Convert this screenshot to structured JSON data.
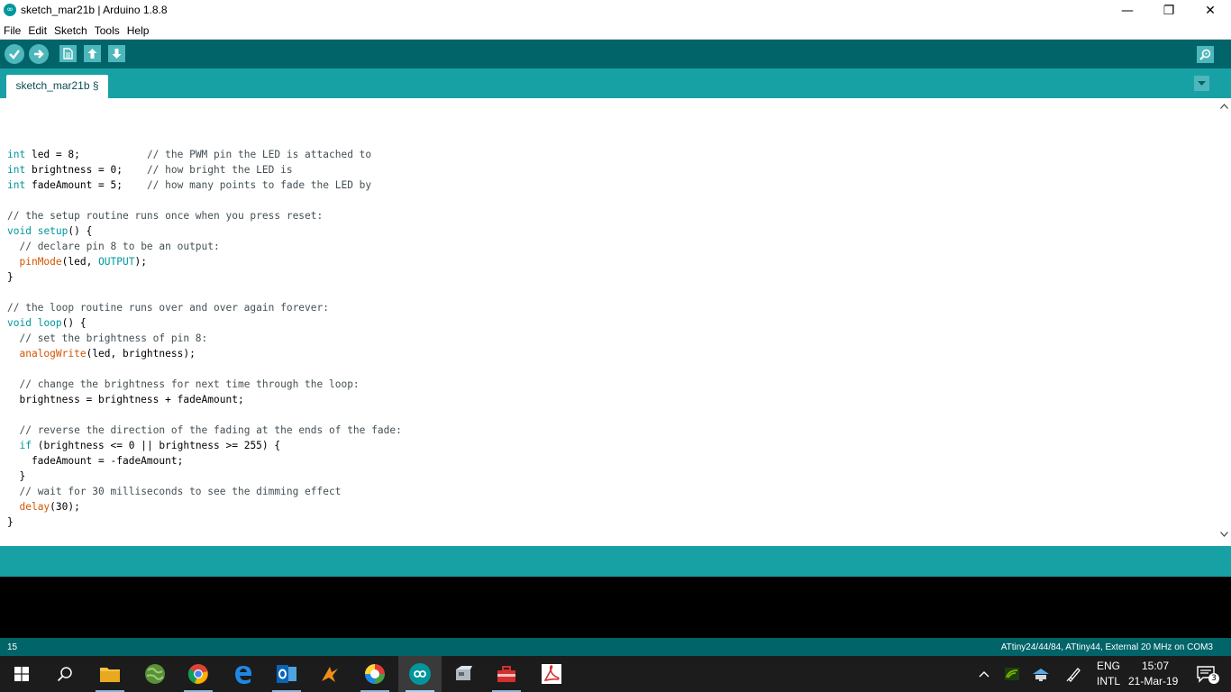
{
  "window": {
    "title": "sketch_mar21b | Arduino 1.8.8",
    "app_icon": "∞",
    "minimize": "—",
    "maximize": "❐",
    "close": "✕"
  },
  "menu": [
    "File",
    "Edit",
    "Sketch",
    "Tools",
    "Help"
  ],
  "tab": {
    "label": "sketch_mar21b §"
  },
  "code_lines": [
    [],
    [
      {
        "t": "int",
        "c": "kw"
      },
      {
        "t": " led = 8;           "
      },
      {
        "t": "// the PWM pin the LED is attached to",
        "c": "cm"
      }
    ],
    [
      {
        "t": "int",
        "c": "kw"
      },
      {
        "t": " brightness = 0;    "
      },
      {
        "t": "// how bright the LED is",
        "c": "cm"
      }
    ],
    [
      {
        "t": "int",
        "c": "kw"
      },
      {
        "t": " fadeAmount = 5;    "
      },
      {
        "t": "// how many points to fade the LED by",
        "c": "cm"
      }
    ],
    [],
    [
      {
        "t": "// the setup routine runs once when you press reset:",
        "c": "cm"
      }
    ],
    [
      {
        "t": "void",
        "c": "kw"
      },
      {
        "t": " "
      },
      {
        "t": "setup",
        "c": "kw"
      },
      {
        "t": "() {"
      }
    ],
    [
      {
        "t": "  "
      },
      {
        "t": "// declare pin 8 to be an output:",
        "c": "cm"
      }
    ],
    [
      {
        "t": "  "
      },
      {
        "t": "pinMode",
        "c": "fn"
      },
      {
        "t": "(led, "
      },
      {
        "t": "OUTPUT",
        "c": "const"
      },
      {
        "t": ");"
      }
    ],
    [
      {
        "t": "}"
      }
    ],
    [],
    [
      {
        "t": "// the loop routine runs over and over again forever:",
        "c": "cm"
      }
    ],
    [
      {
        "t": "void",
        "c": "kw"
      },
      {
        "t": " "
      },
      {
        "t": "loop",
        "c": "kw"
      },
      {
        "t": "() {"
      }
    ],
    [
      {
        "t": "  "
      },
      {
        "t": "// set the brightness of pin 8:",
        "c": "cm"
      }
    ],
    [
      {
        "t": "  "
      },
      {
        "t": "analogWrite",
        "c": "fn"
      },
      {
        "t": "(led, brightness);"
      }
    ],
    [],
    [
      {
        "t": "  "
      },
      {
        "t": "// change the brightness for next time through the loop:",
        "c": "cm"
      }
    ],
    [
      {
        "t": "  brightness = brightness + fadeAmount;"
      }
    ],
    [],
    [
      {
        "t": "  "
      },
      {
        "t": "// reverse the direction of the fading at the ends of the fade:",
        "c": "cm"
      }
    ],
    [
      {
        "t": "  "
      },
      {
        "t": "if",
        "c": "kw"
      },
      {
        "t": " (brightness <= 0 || brightness >= 255) {"
      }
    ],
    [
      {
        "t": "    fadeAmount = -fadeAmount;"
      }
    ],
    [
      {
        "t": "  }"
      }
    ],
    [
      {
        "t": "  "
      },
      {
        "t": "// wait for 30 milliseconds to see the dimming effect",
        "c": "cm"
      }
    ],
    [
      {
        "t": "  "
      },
      {
        "t": "delay",
        "c": "fn"
      },
      {
        "t": "(30);"
      }
    ],
    [
      {
        "t": "}"
      }
    ]
  ],
  "footer": {
    "line_number": "15",
    "board": "ATtiny24/44/84, ATtiny44, External 20 MHz on COM3"
  },
  "taskbar": {
    "lang_top": "ENG",
    "lang_bottom": "INTL",
    "time": "15:07",
    "date": "21-Mar-19",
    "notification_count": "3",
    "tray_chevron": "^"
  },
  "colors": {
    "toolbar": "#006468",
    "tabstrip": "#17a1a5",
    "keyword": "#00979c",
    "function": "#d35400"
  }
}
